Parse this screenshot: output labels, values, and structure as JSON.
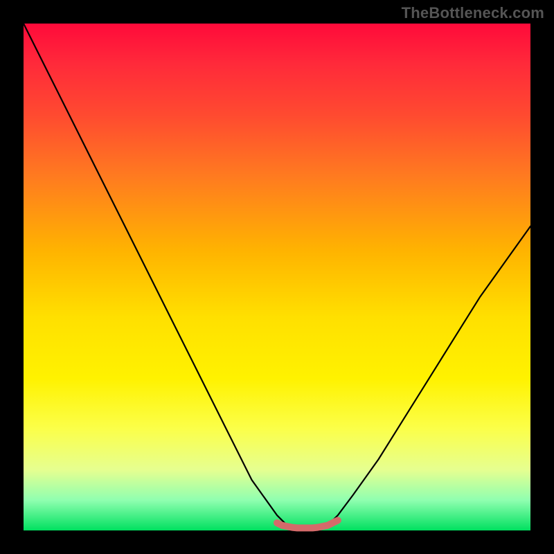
{
  "watermark": "TheBottleneck.com",
  "chart_data": {
    "type": "line",
    "title": "",
    "xlabel": "",
    "ylabel": "",
    "xlim": [
      0,
      1
    ],
    "ylim": [
      0,
      1
    ],
    "grid": false,
    "legend": false,
    "annotations": [],
    "series": [
      {
        "name": "bottleneck_curve",
        "color": "#000000",
        "x": [
          0.0,
          0.05,
          0.1,
          0.15,
          0.2,
          0.25,
          0.3,
          0.35,
          0.4,
          0.45,
          0.5,
          0.52,
          0.55,
          0.58,
          0.6,
          0.62,
          0.65,
          0.7,
          0.75,
          0.8,
          0.85,
          0.9,
          0.95,
          1.0
        ],
        "y": [
          1.0,
          0.9,
          0.8,
          0.7,
          0.6,
          0.5,
          0.4,
          0.3,
          0.2,
          0.1,
          0.03,
          0.01,
          0.005,
          0.005,
          0.01,
          0.03,
          0.07,
          0.14,
          0.22,
          0.3,
          0.38,
          0.46,
          0.53,
          0.6
        ]
      },
      {
        "name": "valley_marker",
        "color": "#d46a6a",
        "x": [
          0.5,
          0.51,
          0.52,
          0.53,
          0.54,
          0.55,
          0.56,
          0.57,
          0.58,
          0.59,
          0.6,
          0.61,
          0.62
        ],
        "y": [
          0.015,
          0.01,
          0.008,
          0.006,
          0.005,
          0.005,
          0.005,
          0.005,
          0.006,
          0.008,
          0.01,
          0.015,
          0.02
        ]
      }
    ],
    "gradient_stops": [
      {
        "pos": 0.0,
        "color": "#ff0a3a"
      },
      {
        "pos": 0.08,
        "color": "#ff2a3a"
      },
      {
        "pos": 0.18,
        "color": "#ff4a30"
      },
      {
        "pos": 0.3,
        "color": "#ff7a20"
      },
      {
        "pos": 0.45,
        "color": "#ffb400"
      },
      {
        "pos": 0.58,
        "color": "#ffe000"
      },
      {
        "pos": 0.7,
        "color": "#fff200"
      },
      {
        "pos": 0.8,
        "color": "#fbff4a"
      },
      {
        "pos": 0.88,
        "color": "#e6ff90"
      },
      {
        "pos": 0.94,
        "color": "#90ffb0"
      },
      {
        "pos": 1.0,
        "color": "#00e060"
      }
    ]
  }
}
